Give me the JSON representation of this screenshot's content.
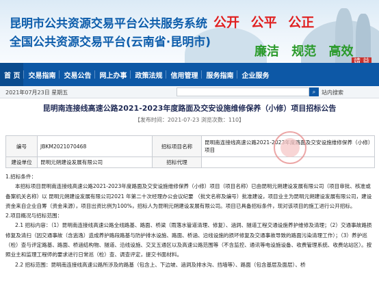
{
  "banner": {
    "title1": "昆明市公共资源交易平台公共服务系统",
    "title2": "全国公共资源交易平台(云南省·昆明市)",
    "slogan1": "公开  公平  公正",
    "slogan2": "廉洁  规范  高效",
    "stamp": "靖  益"
  },
  "nav": [
    "首 页",
    "交易指南",
    "交易公告",
    "网上办事",
    "政策法规",
    "信用管理",
    "服务指南",
    "企业服务"
  ],
  "subbar": {
    "date": "2021年07月23日 星期五",
    "search_placeholder": "",
    "site_search": "站内搜索"
  },
  "page": {
    "title": "昆明南连接线高速公路2021-2023年度路面及交安设施维修保养（小修）项目招标公告",
    "meta": "【发布时间：2021-07-23   浏览次数：110】"
  },
  "info": {
    "code_label": "编号",
    "code_value": "JBKM2021070468",
    "name_label": "招标项目名称",
    "name_value": "昆明南连接线高速公路2021-2023年度路面及交安设施维修保养（小修）项目",
    "unit_label": "建设单位",
    "unit_value": "昆明元朔建设发展有限公司",
    "agent_label": "招标代理"
  },
  "body": {
    "s1": "1.招标条件：",
    "p1": "本招标项目昆明南连接线高速公路2021-2023年度路面及交安设施维修保养（小修）项目（项目名称）已由昆明元朔建设发展有限公司（项目审批、核准或备案机关名称）以 昆明元朔建设发展有限公司2021 年第二十次经理办公会议纪要 （批文名称及编号）批准建设，项目业主为昆明元朔建设发展有限公司，建设资金来自企业自筹（资金来源），项目出资比例为100%，招标人为昆明元朔建设发展有限公司。项目已具备招标条件，现对该项目的施工进行公开招标。",
    "s2": "2.项目概况与招标范围：",
    "p2": "2.1 招标内容：（1）昆明南连接线高速公路全线路基、路面、桥梁（雨落水管道清理、修复）、涵洞、隧道工程交通设施养护维修及清理；（2）交通事故路损修复及清扫（因交通事故（含逃逸）造成养护路段路基与防护排水设施、路面、桥涵、沿线设施的损坏修复及交通事故导致的路面污染清理工作）；（3）养护巡（检）查与评定路基、路面、桥涵结构物、隧道、沿线设施、交叉五通区以及高速公路范围等（不含监控、通讯等电设施设备、收费管理系统、收费站站区）。按照业主和监理工程师的要求进行日常巡（检）查、调查评定，提交书面材料。",
    "p3": "2.2 招标范围：昆明南连接线高速公路所涉及的路基（包含上、下边坡、涵洞及排水沟、挡墙等）、路面（包含基层及面层）、桥"
  }
}
